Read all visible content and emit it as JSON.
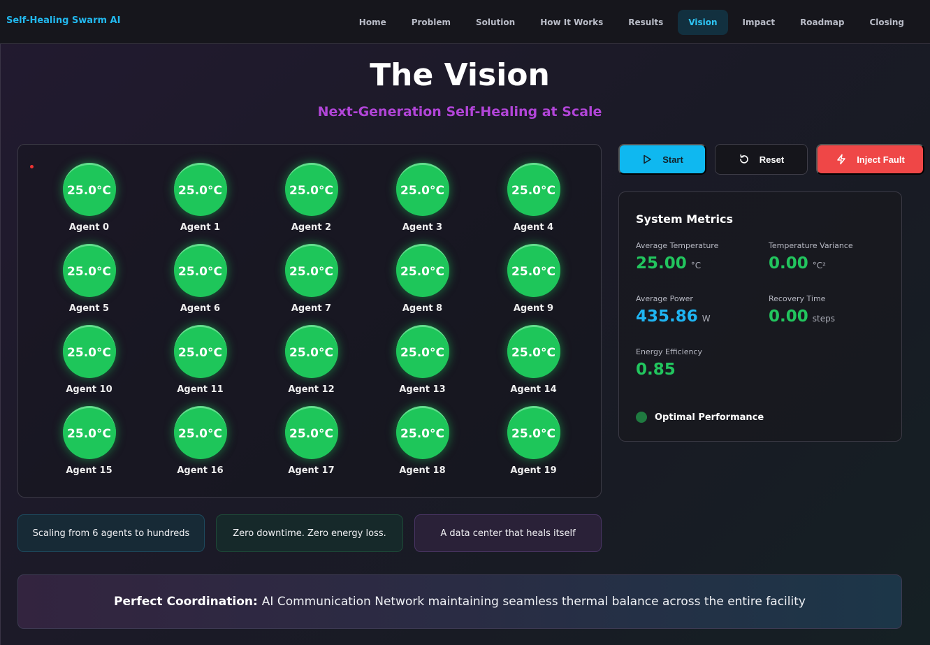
{
  "brand": "Self-Healing Swarm AI",
  "nav": [
    {
      "label": "Home",
      "active": false
    },
    {
      "label": "Problem",
      "active": false
    },
    {
      "label": "Solution",
      "active": false
    },
    {
      "label": "How It Works",
      "active": false
    },
    {
      "label": "Results",
      "active": false
    },
    {
      "label": "Vision",
      "active": true
    },
    {
      "label": "Impact",
      "active": false
    },
    {
      "label": "Roadmap",
      "active": false
    },
    {
      "label": "Closing",
      "active": false
    }
  ],
  "page": {
    "title": "The Vision",
    "subtitle": "Next-Generation Self-Healing at Scale"
  },
  "agents": [
    {
      "label": "Agent 0",
      "temp": "25.0°C"
    },
    {
      "label": "Agent 1",
      "temp": "25.0°C"
    },
    {
      "label": "Agent 2",
      "temp": "25.0°C"
    },
    {
      "label": "Agent 3",
      "temp": "25.0°C"
    },
    {
      "label": "Agent 4",
      "temp": "25.0°C"
    },
    {
      "label": "Agent 5",
      "temp": "25.0°C"
    },
    {
      "label": "Agent 6",
      "temp": "25.0°C"
    },
    {
      "label": "Agent 7",
      "temp": "25.0°C"
    },
    {
      "label": "Agent 8",
      "temp": "25.0°C"
    },
    {
      "label": "Agent 9",
      "temp": "25.0°C"
    },
    {
      "label": "Agent 10",
      "temp": "25.0°C"
    },
    {
      "label": "Agent 11",
      "temp": "25.0°C"
    },
    {
      "label": "Agent 12",
      "temp": "25.0°C"
    },
    {
      "label": "Agent 13",
      "temp": "25.0°C"
    },
    {
      "label": "Agent 14",
      "temp": "25.0°C"
    },
    {
      "label": "Agent 15",
      "temp": "25.0°C"
    },
    {
      "label": "Agent 16",
      "temp": "25.0°C"
    },
    {
      "label": "Agent 17",
      "temp": "25.0°C"
    },
    {
      "label": "Agent 18",
      "temp": "25.0°C"
    },
    {
      "label": "Agent 19",
      "temp": "25.0°C"
    }
  ],
  "controls": {
    "start_label": "Start",
    "reset_label": "Reset",
    "fault_label": "Inject Fault"
  },
  "metrics": {
    "title": "System Metrics",
    "avg_temp": {
      "label": "Average Temperature",
      "value": "25.00",
      "unit": "°C"
    },
    "temp_variance": {
      "label": "Temperature Variance",
      "value": "0.00",
      "unit": "°C²"
    },
    "avg_power": {
      "label": "Average Power",
      "value": "435.86",
      "unit": "W"
    },
    "recovery_time": {
      "label": "Recovery Time",
      "value": "0.00",
      "unit": "steps"
    },
    "energy_efficiency": {
      "label": "Energy Efficiency",
      "value": "0.85"
    },
    "status": "Optimal Performance"
  },
  "taglines": [
    "Scaling from 6 agents to hundreds",
    "Zero downtime. Zero energy loss.",
    "A data center that heals itself"
  ],
  "banner": {
    "bold": "Perfect Coordination:",
    "text": "AI Communication Network maintaining seamless thermal balance across the entire facility"
  },
  "colors": {
    "accent": "#0fb8f0",
    "agent_ok": "#1ec65a",
    "danger": "#ef4747",
    "subtitle": "#b245d8"
  }
}
